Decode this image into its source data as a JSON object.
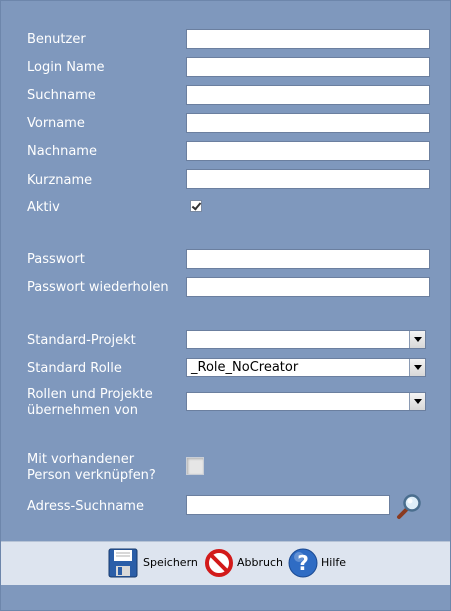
{
  "form": {
    "fields": {
      "benutzer": {
        "label": "Benutzer",
        "value": ""
      },
      "login_name": {
        "label": "Login Name",
        "value": ""
      },
      "suchname": {
        "label": "Suchname",
        "value": ""
      },
      "vorname": {
        "label": "Vorname",
        "value": ""
      },
      "nachname": {
        "label": "Nachname",
        "value": ""
      },
      "kurzname": {
        "label": "Kurzname",
        "value": ""
      },
      "aktiv": {
        "label": "Aktiv",
        "checked": true
      },
      "passwort": {
        "label": "Passwort",
        "value": ""
      },
      "passwort_wiederholen": {
        "label": "Passwort wiederholen",
        "value": ""
      },
      "standard_projekt": {
        "label": "Standard-Projekt",
        "selected": ""
      },
      "standard_rolle": {
        "label": "Standard Rolle",
        "selected": "_Role_NoCreator"
      },
      "rollen_uebernehmen": {
        "label_line1": "Rollen und Projekte",
        "label_line2": "übernehmen von",
        "selected": ""
      },
      "person_verknuepfen": {
        "label_line1": "Mit vorhandener",
        "label_line2": "Person verknüpfen?",
        "checked": false
      },
      "adress_suchname": {
        "label": "Adress-Suchname",
        "value": ""
      }
    }
  },
  "footer": {
    "save_label": "Speichern",
    "cancel_label": "Abbruch",
    "help_label": "Hilfe"
  },
  "colors": {
    "background": "#7f98bd",
    "footer": "#dde4ef",
    "label": "#ffffff"
  },
  "icons": {
    "save": "floppy-disk-icon",
    "cancel": "prohibited-icon",
    "help": "question-mark-icon",
    "search": "magnifier-icon"
  }
}
